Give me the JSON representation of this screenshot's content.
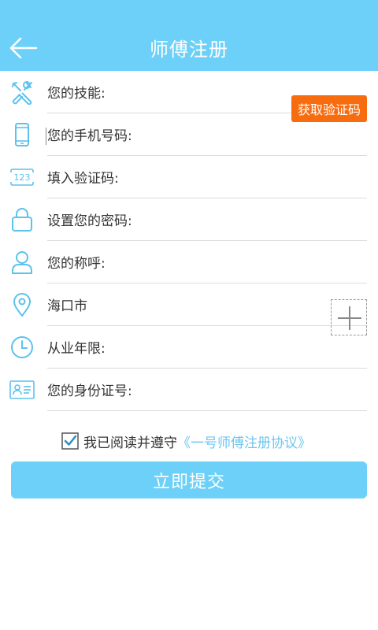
{
  "colors": {
    "primary": "#6dd0f8",
    "accent_orange": "#f86c10",
    "link": "#6dc6ef",
    "icon": "#5cc2ee"
  },
  "header": {
    "title": "师傅注册",
    "back_icon": "arrow-left-icon"
  },
  "form": {
    "fields": [
      {
        "label": "您的技能:",
        "icon": "tools-icon"
      },
      {
        "label": "您的手机号码:",
        "icon": "phone-icon"
      },
      {
        "label": "填入验证码:",
        "icon": "keypad-123-icon"
      },
      {
        "label": "设置您的密码:",
        "icon": "lock-icon"
      },
      {
        "label": "您的称呼:",
        "icon": "user-icon"
      },
      {
        "label": "海口市",
        "icon": "location-icon"
      },
      {
        "label": "从业年限:",
        "icon": "clock-icon"
      },
      {
        "label": "您的身份证号:",
        "icon": "id-card-icon"
      }
    ],
    "get_code_label": "获取验证码"
  },
  "agreement": {
    "checked": true,
    "text": "我已阅读并遵守",
    "link": "《一号师傅注册协议》"
  },
  "submit_label": "立即提交"
}
